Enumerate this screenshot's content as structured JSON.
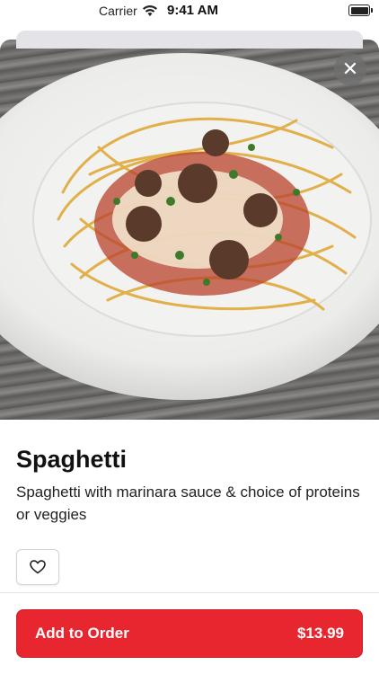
{
  "status_bar": {
    "carrier": "Carrier",
    "time": "9:41 AM"
  },
  "icons": {
    "close": "close-icon",
    "favorite": "heart-icon",
    "wifi": "wifi-icon",
    "battery": "battery-icon"
  },
  "item": {
    "name": "Spaghetti",
    "description": "Spaghetti with marinara sauce & choice of proteins or veggies"
  },
  "order": {
    "button_label": "Add to Order",
    "price": "$13.99"
  },
  "colors": {
    "accent": "#e8262f",
    "background": "#ffffff"
  }
}
